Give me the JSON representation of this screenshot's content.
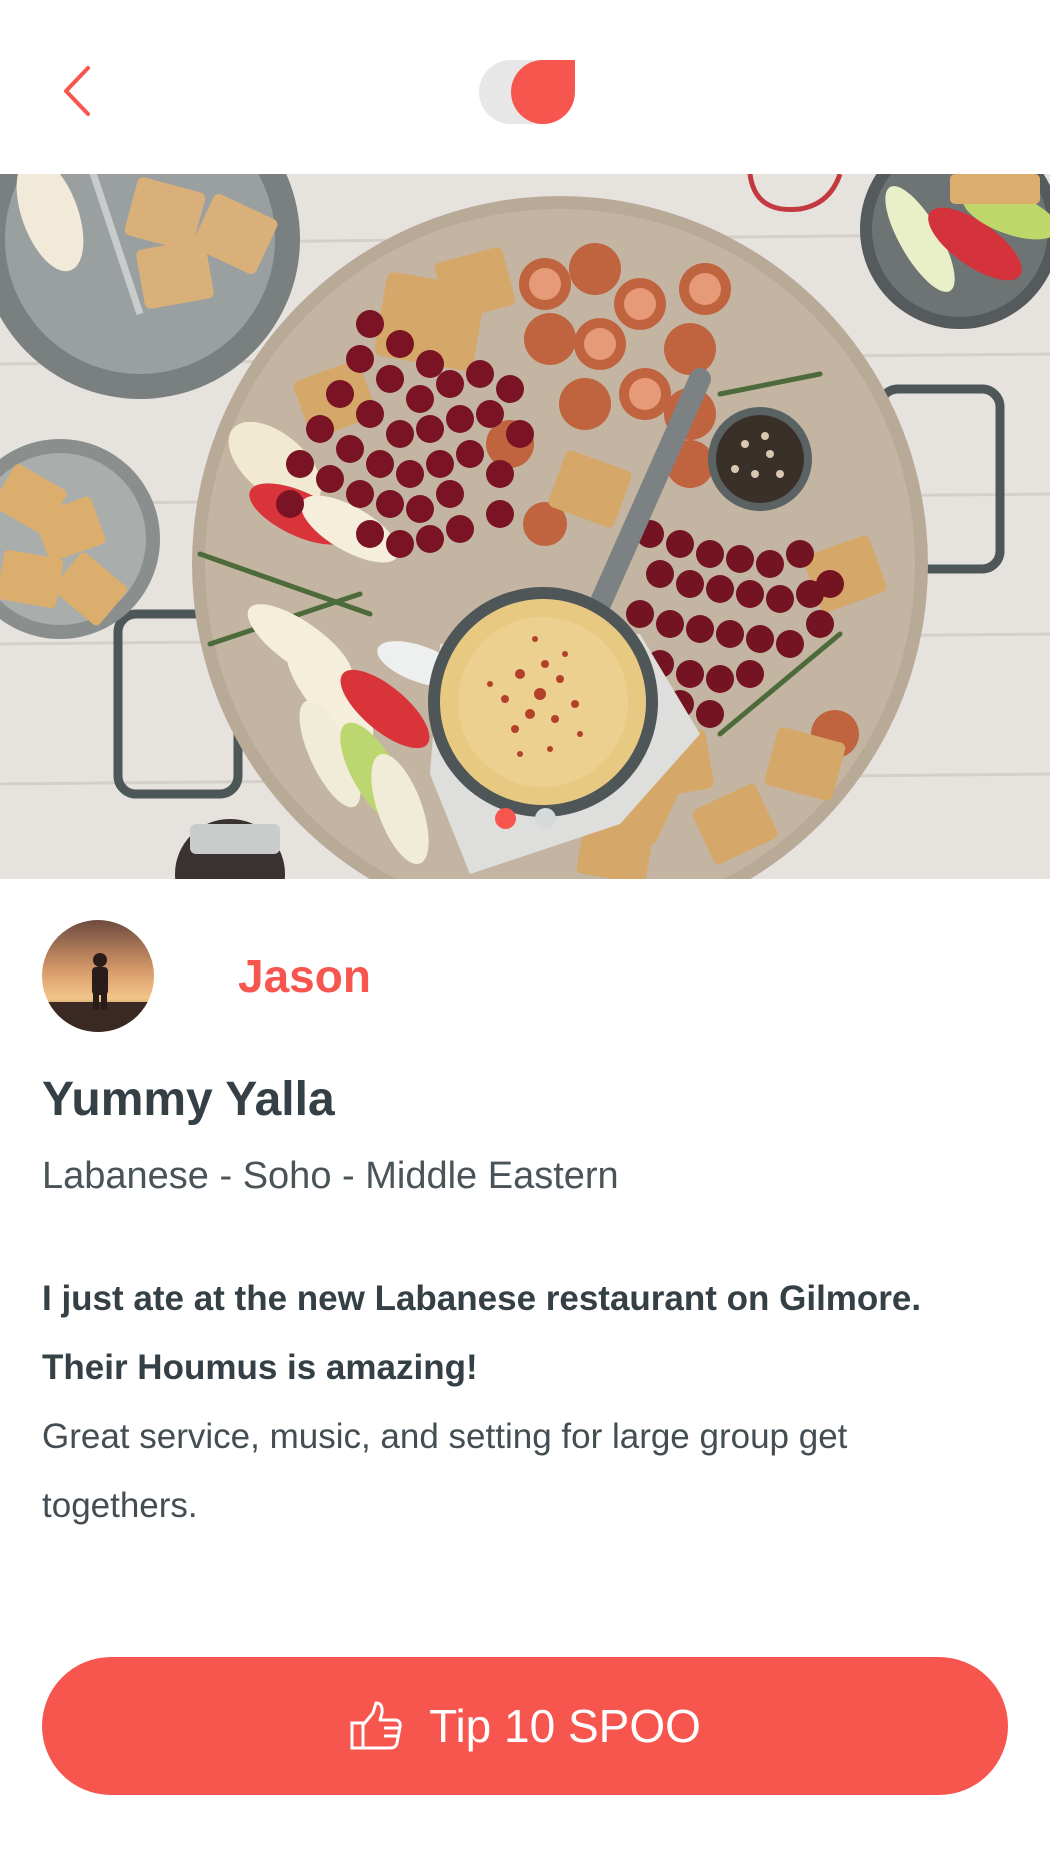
{
  "header": {
    "back_icon": "chevron-left-icon",
    "logo_icon": "app-logo"
  },
  "hero": {
    "image": "food-platter-photo",
    "carousel": {
      "count": 2,
      "active": 1
    }
  },
  "post": {
    "author": {
      "name": "Jason",
      "avatar": "person-sunset-avatar"
    },
    "title": "Yummy Yalla",
    "tags": "Labanese - Soho - Middle Eastern",
    "review_headline": "I just ate at the new Labanese restaurant on Gilmore. Their Houmus is amazing!",
    "review_body": "Great service, music, and setting for large group get togethers."
  },
  "action": {
    "tip_label": "Tip 10 SPOO",
    "tip_icon": "thumbs-up-icon"
  },
  "colors": {
    "accent": "#f7564f",
    "text_dark": "#344045",
    "dot_inactive": "#d6dadb"
  }
}
